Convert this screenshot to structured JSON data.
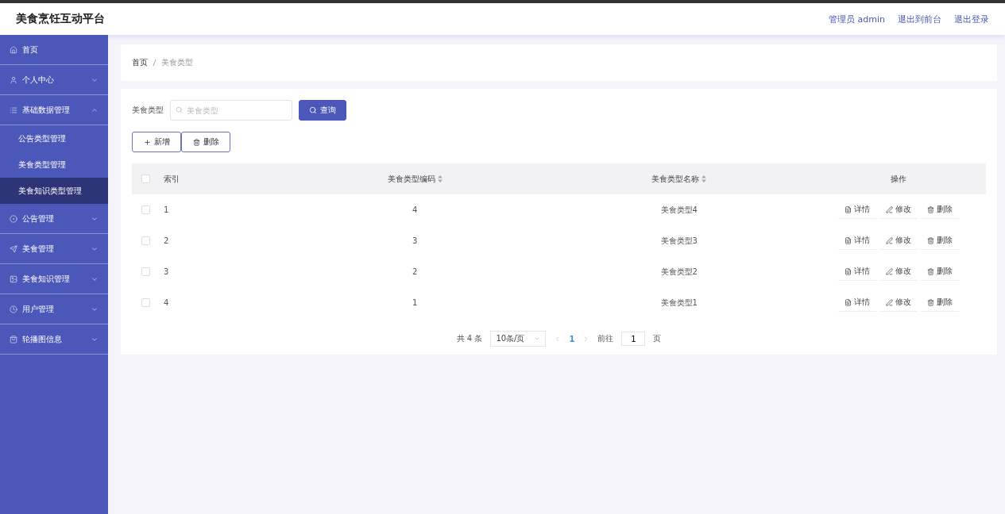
{
  "header": {
    "title": "美食烹饪互动平台",
    "links": [
      "管理员 admin",
      "退出到前台",
      "退出登录"
    ]
  },
  "sidebar": {
    "items": [
      {
        "label": "首页",
        "kind": "link"
      },
      {
        "label": "个人中心",
        "kind": "group",
        "expanded": false
      },
      {
        "label": "基础数据管理",
        "kind": "group",
        "expanded": true,
        "children": [
          {
            "label": "公告类型管理",
            "selected": false
          },
          {
            "label": "美食类型管理",
            "selected": false
          },
          {
            "label": "美食知识类型管理",
            "selected": true
          }
        ]
      },
      {
        "label": "公告管理",
        "kind": "group",
        "expanded": false
      },
      {
        "label": "美食管理",
        "kind": "group",
        "expanded": false
      },
      {
        "label": "美食知识管理",
        "kind": "group",
        "expanded": false
      },
      {
        "label": "用户管理",
        "kind": "group",
        "expanded": false
      },
      {
        "label": "轮播图信息",
        "kind": "group",
        "expanded": false
      }
    ]
  },
  "breadcrumb": [
    "首页",
    "美食类型"
  ],
  "search": {
    "label": "美食类型",
    "placeholder": "美食类型",
    "button": "查询"
  },
  "actions": [
    "新增",
    "删除"
  ],
  "table": {
    "select_all": {
      "checked": false
    },
    "columns": [
      "索引",
      "美食类型编码",
      "美食类型名称",
      "操作"
    ],
    "rows": [
      {
        "checked": false,
        "index": "1",
        "code": "4",
        "name": "美食类型4",
        "actions": [
          "详情",
          "修改",
          "删除"
        ]
      },
      {
        "checked": false,
        "index": "2",
        "code": "3",
        "name": "美食类型3",
        "actions": [
          "详情",
          "修改",
          "删除"
        ]
      },
      {
        "checked": false,
        "index": "3",
        "code": "2",
        "name": "美食类型2",
        "actions": [
          "详情",
          "修改",
          "删除"
        ]
      },
      {
        "checked": false,
        "index": "4",
        "code": "1",
        "name": "美食类型1",
        "actions": [
          "详情",
          "修改",
          "删除"
        ]
      }
    ]
  },
  "pagination": {
    "total": "共 4 条",
    "page_size": "10条/页",
    "pages": [
      {
        "label": "1",
        "selected": true
      }
    ],
    "goto_label": "前往",
    "goto_value": "1",
    "goto_suffix": "页"
  }
}
